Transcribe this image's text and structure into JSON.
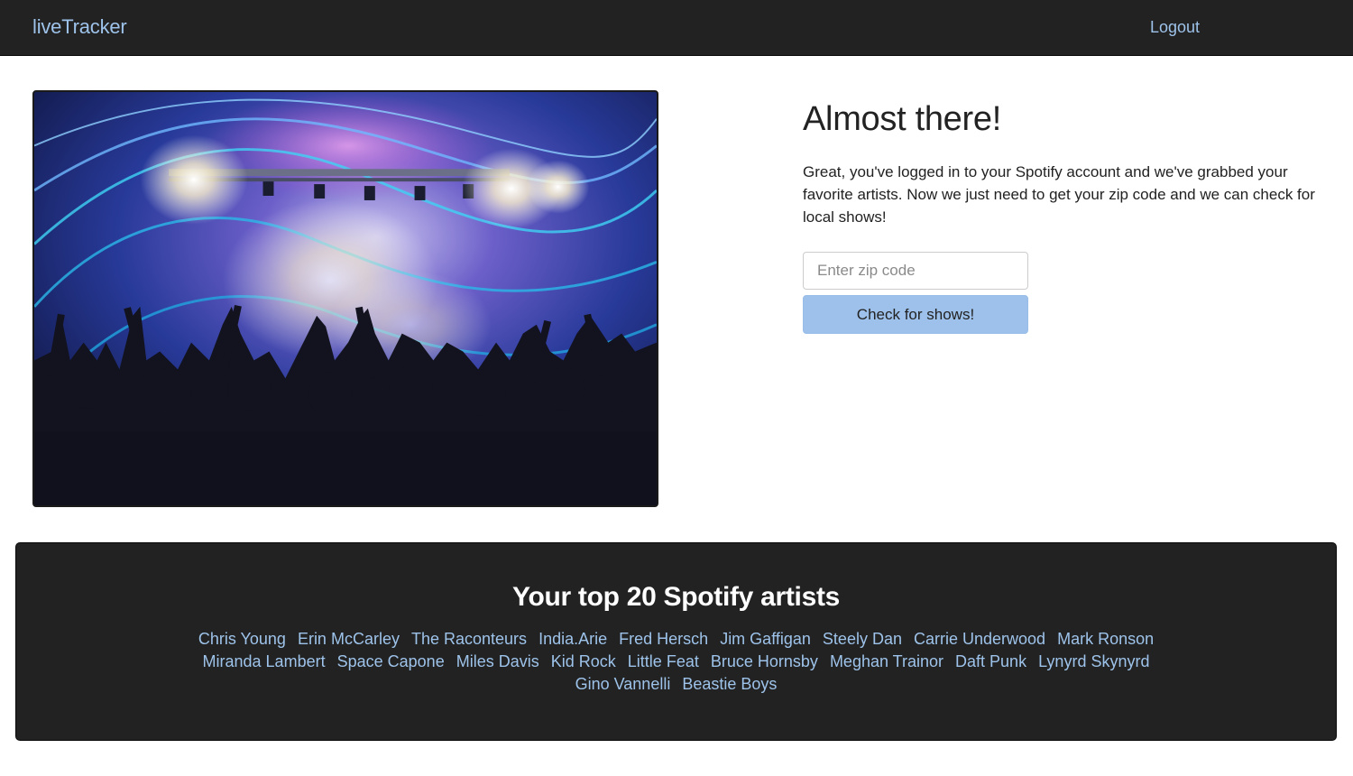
{
  "navbar": {
    "brand": "liveTracker",
    "logout_label": "Logout"
  },
  "hero": {
    "image_alt": "concert crowd in front of a lit stage"
  },
  "panel": {
    "title": "Almost there!",
    "intro": "Great, you've logged in to your Spotify account and we've grabbed your favorite artists. Now we just need to get your zip code and we can check for local shows!",
    "zip_placeholder": "Enter zip code",
    "zip_value": "",
    "button_label": "Check for shows!"
  },
  "artists": {
    "heading": "Your top 20 Spotify artists",
    "items": [
      "Chris Young",
      "Erin McCarley",
      "The Raconteurs",
      "India.Arie",
      "Fred Hersch",
      "Jim Gaffigan",
      "Steely Dan",
      "Carrie Underwood",
      "Mark Ronson",
      "Miranda Lambert",
      "Space Capone",
      "Miles Davis",
      "Kid Rock",
      "Little Feat",
      "Bruce Hornsby",
      "Meghan Trainor",
      "Daft Punk",
      "Lynyrd Skynyrd",
      "Gino Vannelli",
      "Beastie Boys"
    ]
  },
  "colors": {
    "navbar_bg": "#222222",
    "link": "#9ec3ea",
    "button_bg": "#9dc1ea"
  }
}
